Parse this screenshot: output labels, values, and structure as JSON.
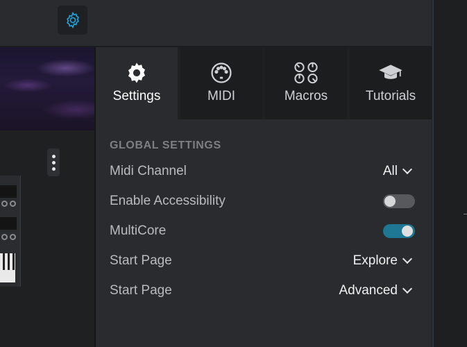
{
  "topbar": {
    "settings_icon": "gear-icon",
    "accent": "#1e9fd6"
  },
  "preview": {
    "more_icon": "vertical-ellipsis-icon"
  },
  "tabs": [
    {
      "label": "Settings",
      "icon": "gear-icon",
      "active": true
    },
    {
      "label": "MIDI",
      "icon": "midi-port-icon",
      "active": false
    },
    {
      "label": "Macros",
      "icon": "knobs-icon",
      "active": false
    },
    {
      "label": "Tutorials",
      "icon": "graduation-cap-icon",
      "active": false
    }
  ],
  "settings": {
    "section_title": "GLOBAL SETTINGS",
    "rows": [
      {
        "name": "Midi Channel",
        "type": "dropdown",
        "value": "All"
      },
      {
        "name": "Enable Accessibility",
        "type": "toggle",
        "on": false
      },
      {
        "name": "MultiCore",
        "type": "toggle",
        "on": true
      },
      {
        "name": "Start Page",
        "type": "dropdown",
        "value": "Explore"
      },
      {
        "name": "Start Page",
        "type": "dropdown",
        "value": "Advanced"
      }
    ]
  },
  "colors": {
    "toggle_on": "#1e7894",
    "toggle_off": "#58595d",
    "panel_bg": "#2a2b2e"
  }
}
